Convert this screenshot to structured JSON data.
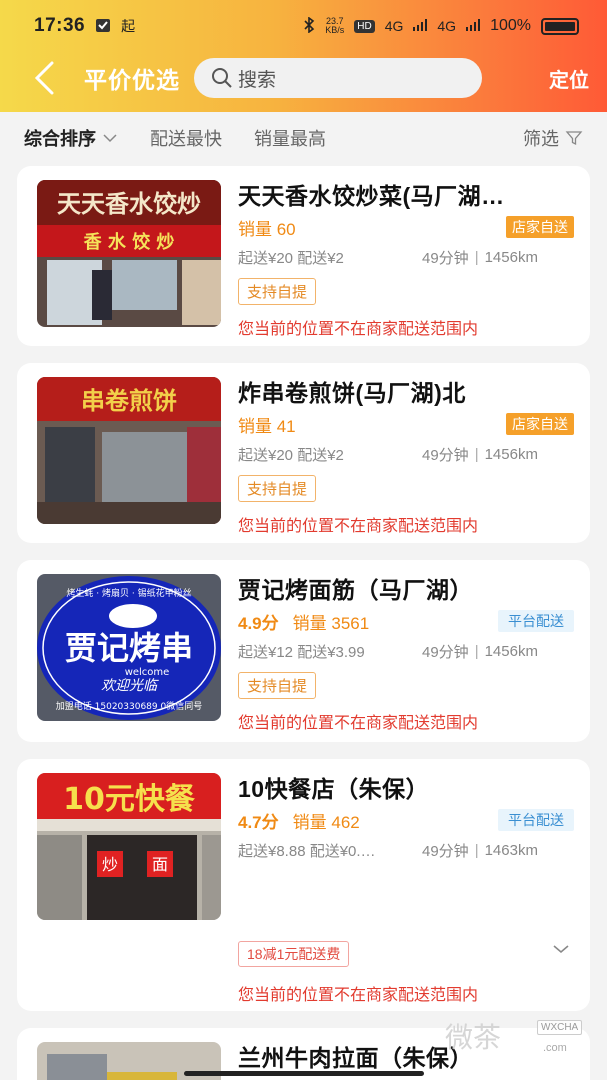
{
  "status_bar": {
    "time": "17:36",
    "carrier_icon": "起",
    "net_speed": "23.7\nKB/s",
    "hd": "HD",
    "signal1": "4G",
    "signal2": "4G",
    "battery": "100%"
  },
  "header": {
    "title": "平价优选",
    "search_placeholder": "搜索",
    "locate_label": "定位"
  },
  "sort_bar": {
    "active": "综合排序",
    "options": [
      "配送最快",
      "销量最高"
    ],
    "filter": "筛选"
  },
  "stores": [
    {
      "name": "天天香水饺炒菜(马厂湖…",
      "rating": "",
      "sales": "销量 60",
      "delivery_badge": "店家自送",
      "fees": "起送¥20 配送¥2",
      "time": "49分钟",
      "distance": "1456km",
      "self_pickup": "支持自提",
      "warning": "您当前的位置不在商家配送范围内"
    },
    {
      "name": "炸串卷煎饼(马厂湖)北",
      "rating": "",
      "sales": "销量 41",
      "delivery_badge": "店家自送",
      "fees": "起送¥20 配送¥2",
      "time": "49分钟",
      "distance": "1456km",
      "self_pickup": "支持自提",
      "warning": "您当前的位置不在商家配送范围内"
    },
    {
      "name": "贾记烤面筋（马厂湖）",
      "rating": "4.9分",
      "sales": "销量 3561",
      "delivery_badge": "平台配送",
      "fees": "起送¥12 配送¥3.99",
      "time": "49分钟",
      "distance": "1456km",
      "self_pickup": "支持自提",
      "warning": "您当前的位置不在商家配送范围内"
    },
    {
      "name": "10快餐店（朱保）",
      "rating": "4.7分",
      "sales": "销量 462",
      "delivery_badge": "平台配送",
      "fees": "起送¥8.88 配送¥0.…",
      "time": "49分钟",
      "distance": "1463km",
      "discount": "18减1元配送费",
      "warning": "您当前的位置不在商家配送范围内"
    },
    {
      "name": "兰州牛肉拉面（朱保）"
    }
  ],
  "thumb_text": {
    "s1_sign": "天天香水饺炒",
    "s1_sign2": "香 水 饺 炒",
    "s2_sign": "串卷煎饼",
    "s3_top": "烤生蚝 · 烤扇贝 · 锡纸花甲粉丝",
    "s3_main": "贾记烤串",
    "s3_welcome": "welcome",
    "s3_script": "欢迎光临",
    "s3_phone": "加盟电话 15020330689 0微信同号",
    "s4_sign": "10元快餐",
    "s4_door1": "炒",
    "s4_door2": "面"
  },
  "watermark": {
    "text": "微茶",
    "site": "WXCHA",
    "com": ".com"
  },
  "colors": {
    "accent_orange": "#f08a14",
    "warning_red": "#e23b2f",
    "platform_blue": "#3a8fd2",
    "store_badge": "#f5a02a"
  }
}
